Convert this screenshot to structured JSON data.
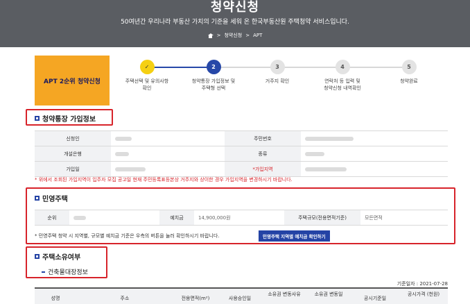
{
  "header": {
    "title": "청약신청",
    "subtitle": "50여년간 우리나라 부동산 가치의 기준을 세워 온 한국부동산원 주택청약 서비스입니다.",
    "breadcrumb": [
      "청약신청",
      "APT"
    ]
  },
  "steps": {
    "current_label": "APT 2순위 청약신청",
    "items": [
      {
        "num": "✓",
        "label_1": "주택선택 및 유의사항",
        "label_2": "확인",
        "state": "done"
      },
      {
        "num": "2",
        "label_1": "청약통장 가입정보 및",
        "label_2": "주택형 선택",
        "state": "current"
      },
      {
        "num": "3",
        "label_1": "거주지 확인",
        "label_2": "",
        "state": "todo"
      },
      {
        "num": "4",
        "label_1": "연락처 등 입력 및",
        "label_2": "청약신청 내역확인",
        "state": "todo"
      },
      {
        "num": "5",
        "label_1": "청약완료",
        "label_2": "",
        "state": "todo"
      }
    ]
  },
  "account_section": {
    "title": "청약통장 가입정보",
    "labels": {
      "applicant": "신청인",
      "resident_no": "주민번호",
      "bank": "개설은행",
      "type": "종류",
      "join_date": "가입일",
      "join_region": "가입지역"
    },
    "required_mark": "*",
    "warning": "* 위에서 조회된 가입지역이 입주자 모집 공고일 현재 주민등록표등본상 거주지와 상이한 경우 가입지역을 변경하시기 바랍니다."
  },
  "private_section": {
    "title": "민영주택",
    "rank_label": "순위",
    "deposit_label": "예치금",
    "deposit_value": "14,900,000원",
    "size_label": "주택규모(전용면적기준)",
    "size_value": "모든면적",
    "note": "* 민영주택 청약 시 지역별, 규모별 예치금 기준은 우측의 버튼을 눌러 확인하시기 바랍니다.",
    "button": "민영주택 지역별 예치금 확인하기"
  },
  "ownership_section": {
    "title": "주택소유여부",
    "sub_title": "건축물대장정보",
    "ref_date": "기준일자 : 2021-07-28",
    "columns": [
      "성명",
      "주소",
      "전용면적(m²)",
      "사용승인일",
      "소유권 변동사유",
      "소유권 변동일",
      "공시기준일",
      "공시가격 (천원)"
    ]
  },
  "colors": {
    "accent": "#2443a5",
    "step_head": "#f5a623",
    "alert": "#d7232a"
  }
}
